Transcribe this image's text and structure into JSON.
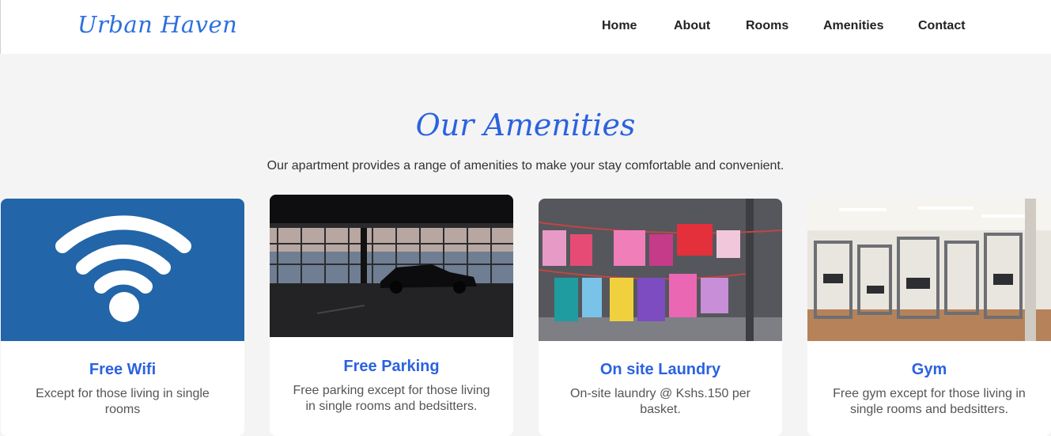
{
  "nav": {
    "logo": "Urban Haven",
    "links": [
      "Home",
      "About",
      "Rooms",
      "Amenities",
      "Contact"
    ]
  },
  "section": {
    "title": "Our Amenities",
    "description": "Our apartment provides a range of amenities to make your stay comfortable and convenient."
  },
  "amenities": [
    {
      "title": "Free Wifi",
      "text": "Except for those living in single rooms",
      "icon": "wifi-icon"
    },
    {
      "title": "Free Parking",
      "text": "Free parking except for those living in single rooms and bedsitters.",
      "icon": "parking-garage-photo"
    },
    {
      "title": "On site Laundry",
      "text": "On-site laundry @ Kshs.150 per basket.",
      "icon": "laundry-photo"
    },
    {
      "title": "Gym",
      "text": "Free gym except for those living in single rooms and bedsitters.",
      "icon": "gym-photo"
    }
  ],
  "colors": {
    "accent": "#2b62e0",
    "wifi_bg": "#2265a8",
    "background": "#f4f4f4"
  }
}
